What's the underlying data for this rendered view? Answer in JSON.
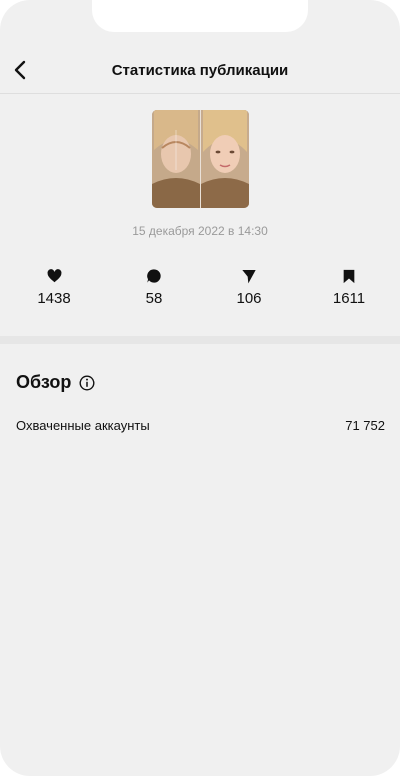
{
  "header": {
    "title": "Статистика публикации",
    "back_icon": "chevron-left-icon"
  },
  "post": {
    "date": "15 декабря 2022 в 14:30",
    "thumbnail_alt": "before-after face photo"
  },
  "stats": [
    {
      "icon": "heart-icon",
      "value": "1438"
    },
    {
      "icon": "comment-icon",
      "value": "58"
    },
    {
      "icon": "send-icon",
      "value": "106"
    },
    {
      "icon": "bookmark-icon",
      "value": "1611"
    }
  ],
  "overview": {
    "title": "Обзор",
    "info_icon": "info-icon",
    "rows": [
      {
        "label": "Охваченные аккаунты",
        "value": "71 752"
      }
    ]
  },
  "colors": {
    "background": "#f0f0f0",
    "text": "#111111",
    "muted": "#9a9a9a"
  }
}
